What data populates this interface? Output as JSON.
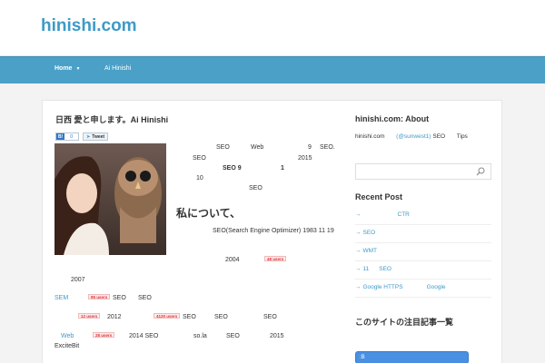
{
  "site": {
    "title": "hinishi.com"
  },
  "nav": {
    "items": [
      {
        "label": "Home",
        "has_dropdown": true,
        "active": true
      },
      {
        "label": "Ai Hinishi"
      }
    ]
  },
  "post": {
    "title": "日西 愛と申します。Ai Hinishi",
    "share": {
      "hatena_icon": "B!",
      "hatena_count": "0",
      "tweet_label": "Tweet"
    },
    "lines": [
      {
        "text": "SEO",
        "id": "l1a"
      },
      {
        "text": "Web",
        "id": "l1b"
      },
      {
        "text": "9",
        "id": "l1c"
      },
      {
        "text": "SEO.",
        "id": "l1d"
      },
      {
        "text": "SEO",
        "id": "l2a"
      },
      {
        "text": "2015",
        "id": "l2b"
      },
      {
        "text": "SEO 9",
        "id": "l3a"
      },
      {
        "text": "1",
        "id": "l3b"
      },
      {
        "text": "10",
        "id": "l4a"
      },
      {
        "text": "SEO",
        "id": "l5a"
      }
    ],
    "heading": "私について、",
    "para": [
      {
        "text": "SEO(Search Engine Optimizer) 1983 11 19"
      },
      {
        "text": "2004"
      },
      {
        "text": "2007"
      },
      {
        "text": "SEM"
      },
      {
        "text": "SEO"
      },
      {
        "text": "SEO"
      },
      {
        "text": "2012"
      },
      {
        "text": "SEO"
      },
      {
        "text": "SEO"
      },
      {
        "text": "SEO"
      },
      {
        "text": "Web"
      },
      {
        "text": "2014 SEO"
      },
      {
        "text": "so.la"
      },
      {
        "text": "SEO"
      },
      {
        "text": "2015"
      },
      {
        "text": "ExciteBit"
      }
    ],
    "badges": [
      "48 users",
      "95 users",
      "12 users",
      "4120 users",
      "28 users"
    ]
  },
  "sidebar": {
    "about_title": "hinishi.com: About",
    "about_text_pre": "hinishi.com",
    "about_link": "(@sunwest1)",
    "about_text_post": "SEO",
    "about_tips": "Tips",
    "search": {
      "placeholder": "",
      "icon": "search-icon"
    },
    "recent_title": "Recent Post",
    "recent": [
      {
        "pre": "",
        "label": "CTR"
      },
      {
        "pre": "",
        "label": "SEO"
      },
      {
        "pre": "",
        "label": "WMT"
      },
      {
        "pre": "11",
        "label": "SEO"
      },
      {
        "pre": "Google HTTPS",
        "label": "Google"
      }
    ],
    "section3_title": "このサイトの注目記事一覧",
    "blue_button": ":B"
  },
  "colors": {
    "accent": "#4aa0c7",
    "link": "#3e9ac6",
    "badge": "#e0353b"
  }
}
